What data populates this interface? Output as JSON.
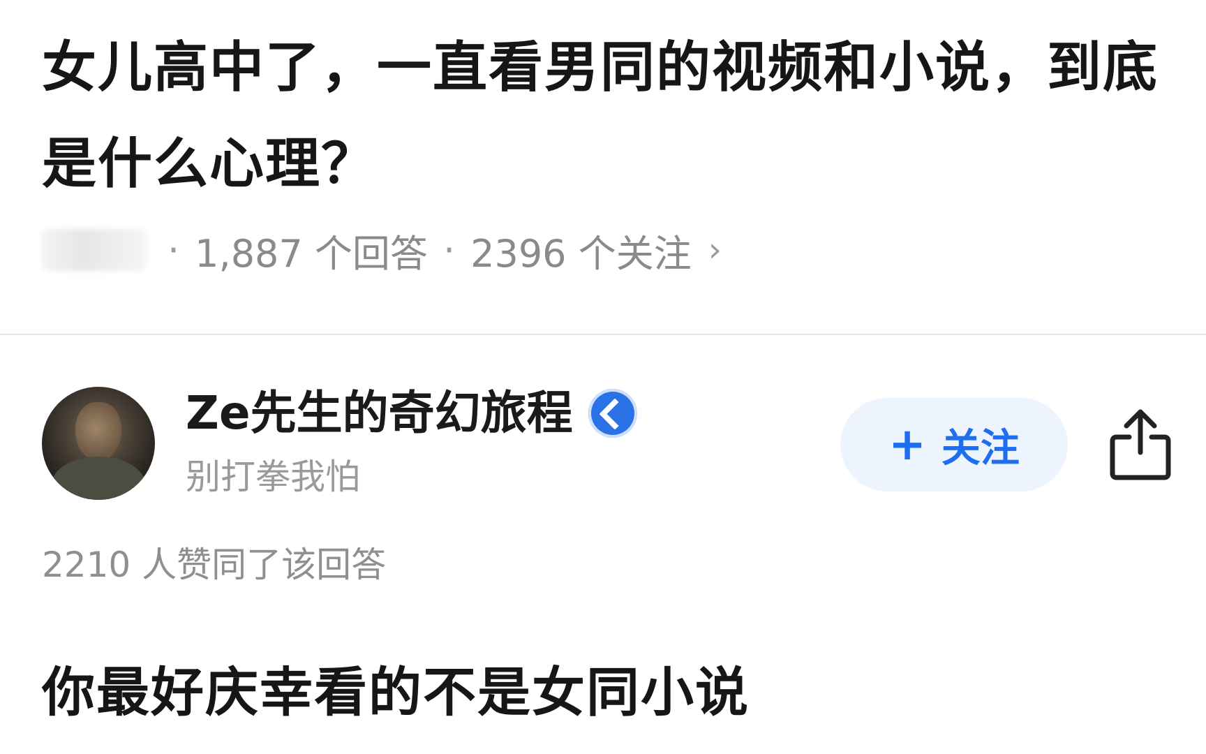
{
  "question": {
    "title": "女儿高中了，一直看男同的视频和小说，到底是什么心理？",
    "answer_count": "1,887 个回答",
    "follower_count": "2396 个关注",
    "separator": "·",
    "chevron": "›"
  },
  "answer": {
    "author": {
      "name": "Ze先生的奇幻旅程",
      "bio": "别打拳我怕",
      "badge_icon": "verified-badge-icon",
      "avatar_icon": "avatar"
    },
    "follow_button": {
      "plus": "+",
      "label": "关注"
    },
    "share_icon": "share-icon",
    "upvote_text": "2210 人赞同了该回答",
    "content": "你最好庆幸看的不是女同小说"
  },
  "colors": {
    "accent": "#1f6ef0",
    "follow_bg": "#eef4fe",
    "muted_text": "#8a8a8a",
    "badge": "#2a72e6"
  }
}
